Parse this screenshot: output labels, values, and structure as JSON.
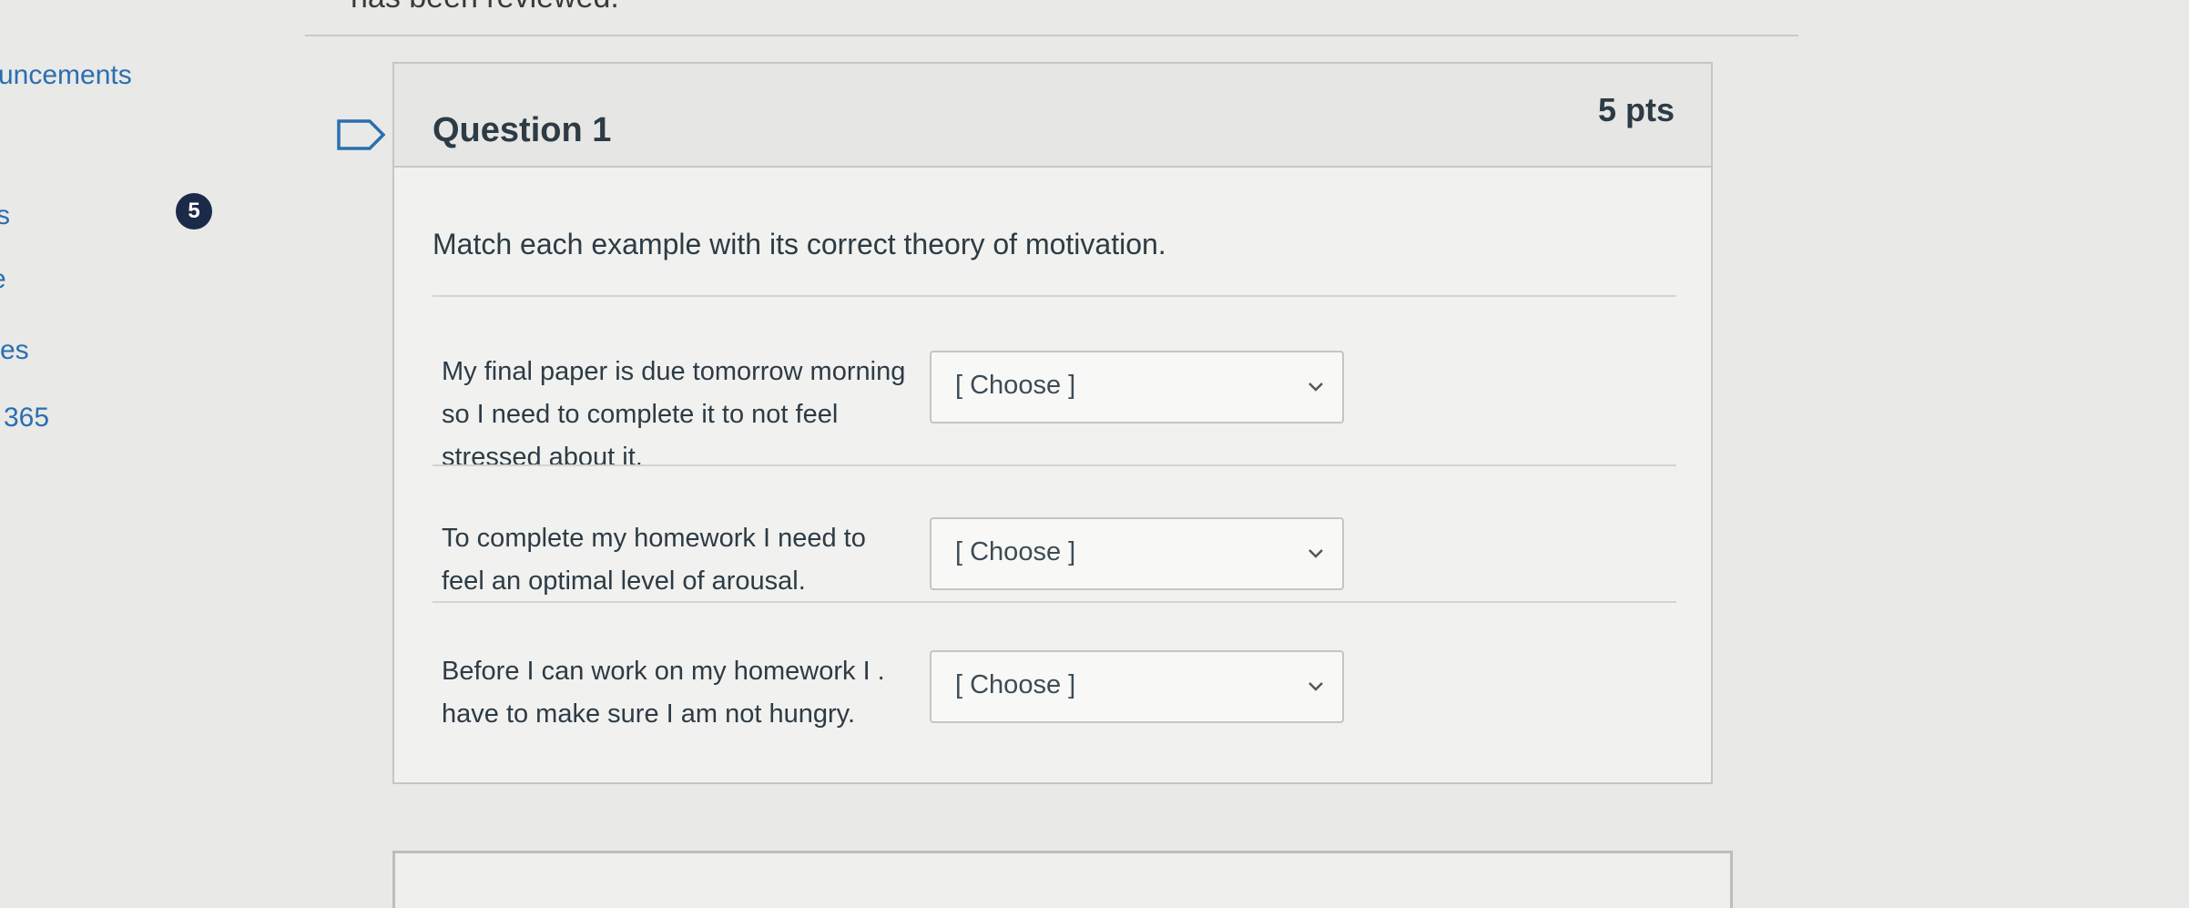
{
  "page": {
    "top_note": "has been reviewed.",
    "badge_count": "5"
  },
  "sidebar": {
    "items": [
      {
        "label": "uncements"
      },
      {
        "label": "s"
      },
      {
        "label": "e"
      },
      {
        "label": "es"
      },
      {
        "label": "365"
      }
    ]
  },
  "question": {
    "title": "Question 1",
    "points": "5 pts",
    "prompt": "Match each example with its correct theory of motivation.",
    "rows": [
      {
        "text": "My final paper is due tomorrow morning so I need to complete it to not feel stressed about it.",
        "selected": "[ Choose ]"
      },
      {
        "text": "To complete my homework I need to feel an optimal level of arousal.",
        "selected": "[ Choose ]"
      },
      {
        "text": "Before I can work on my homework I . have to make sure I am not hungry.",
        "selected": "[ Choose ]"
      }
    ]
  },
  "icons": {
    "flag": "flag-icon",
    "chevron": "chevron-down-icon"
  },
  "colors": {
    "page_bg": "#e9e9e7",
    "link": "#2a6fb0",
    "badge": "#1b2a48",
    "text": "#2d3b45"
  }
}
